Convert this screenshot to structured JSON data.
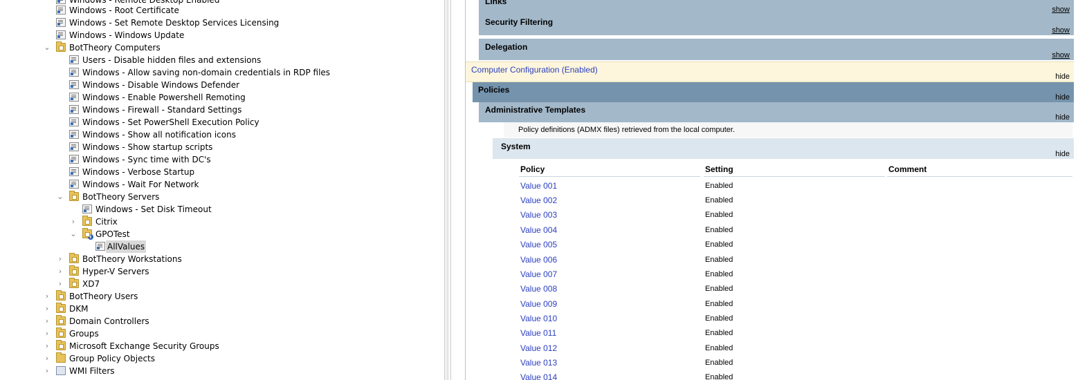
{
  "tree": {
    "items": [
      {
        "label": "Windows - Remote Desktop Enabled",
        "icon": "gpo-link-icon"
      },
      {
        "label": "Windows - Root Certificate",
        "icon": "gpo-link-icon"
      },
      {
        "label": "Windows - Set Remote Desktop Services Licensing",
        "icon": "gpo-link-icon"
      },
      {
        "label": "Windows - Windows Update",
        "icon": "gpo-link-icon"
      },
      {
        "label": "BotTheory Computers",
        "icon": "ou-folder-icon",
        "expander": "⌄"
      },
      {
        "label": "Users - Disable hidden files and extensions",
        "icon": "gpo-link-icon"
      },
      {
        "label": "Windows - Allow saving non-domain credentials in RDP files",
        "icon": "gpo-link-icon"
      },
      {
        "label": "Windows - Disable Windows Defender",
        "icon": "gpo-link-icon"
      },
      {
        "label": "Windows - Enable Powershell Remoting",
        "icon": "gpo-link-icon"
      },
      {
        "label": "Windows - Firewall - Standard Settings",
        "icon": "gpo-link-icon"
      },
      {
        "label": "Windows - Set PowerShell Execution Policy",
        "icon": "gpo-link-icon"
      },
      {
        "label": "Windows - Show all notification icons",
        "icon": "gpo-link-icon"
      },
      {
        "label": "Windows - Show startup scripts",
        "icon": "gpo-link-icon"
      },
      {
        "label": "Windows - Sync time with DC's",
        "icon": "gpo-link-icon"
      },
      {
        "label": "Windows - Verbose Startup",
        "icon": "gpo-link-icon"
      },
      {
        "label": "Windows - Wait For Network",
        "icon": "gpo-link-icon"
      },
      {
        "label": "BotTheory Servers",
        "icon": "ou-folder-icon",
        "expander": "⌄"
      },
      {
        "label": "Windows - Set Disk Timeout",
        "icon": "gpo-link-icon"
      },
      {
        "label": "Citrix",
        "icon": "ou-folder-icon",
        "expander": "›"
      },
      {
        "label": "GPOTest",
        "icon": "ou-folder-info-icon",
        "expander": "⌄"
      },
      {
        "label": "AllValues",
        "icon": "gpo-link-icon",
        "selected": true
      },
      {
        "label": "BotTheory Workstations",
        "icon": "ou-folder-icon",
        "expander": "›"
      },
      {
        "label": "Hyper-V Servers",
        "icon": "ou-folder-icon",
        "expander": "›"
      },
      {
        "label": "XD7",
        "icon": "ou-folder-icon",
        "expander": "›"
      },
      {
        "label": "BotTheory Users",
        "icon": "ou-folder-icon",
        "expander": "›"
      },
      {
        "label": "DKM",
        "icon": "ou-folder-icon",
        "expander": "›"
      },
      {
        "label": "Domain Controllers",
        "icon": "ou-folder-icon",
        "expander": "›"
      },
      {
        "label": "Groups",
        "icon": "ou-folder-icon",
        "expander": "›"
      },
      {
        "label": "Microsoft Exchange Security Groups",
        "icon": "ou-folder-icon",
        "expander": "›"
      },
      {
        "label": "Group Policy Objects",
        "icon": "folder-icon",
        "expander": "›"
      },
      {
        "label": "WMI Filters",
        "icon": "filter-folder-icon",
        "expander": "›"
      }
    ]
  },
  "report": {
    "links": {
      "title": "Links",
      "toggle": "show"
    },
    "security_filtering": {
      "title": "Security Filtering",
      "toggle": "show"
    },
    "delegation": {
      "title": "Delegation",
      "toggle": "show"
    },
    "computer_config": {
      "title": "Computer Configuration (Enabled)",
      "toggle": "hide"
    },
    "policies": {
      "title": "Policies",
      "toggle": "hide"
    },
    "admin_templates": {
      "title": "Administrative Templates",
      "toggle": "hide"
    },
    "admx_note": "Policy definitions (ADMX files) retrieved from the local computer.",
    "system": {
      "title": "System",
      "toggle": "hide"
    },
    "table": {
      "headers": {
        "policy": "Policy",
        "setting": "Setting",
        "comment": "Comment"
      },
      "rows": [
        {
          "policy": "Value 001",
          "setting": "Enabled"
        },
        {
          "policy": "Value 002",
          "setting": "Enabled"
        },
        {
          "policy": "Value 003",
          "setting": "Enabled"
        },
        {
          "policy": "Value 004",
          "setting": "Enabled"
        },
        {
          "policy": "Value 005",
          "setting": "Enabled"
        },
        {
          "policy": "Value 006",
          "setting": "Enabled"
        },
        {
          "policy": "Value 007",
          "setting": "Enabled"
        },
        {
          "policy": "Value 008",
          "setting": "Enabled"
        },
        {
          "policy": "Value 009",
          "setting": "Enabled"
        },
        {
          "policy": "Value 010",
          "setting": "Enabled"
        },
        {
          "policy": "Value 011",
          "setting": "Enabled"
        },
        {
          "policy": "Value 012",
          "setting": "Enabled"
        },
        {
          "policy": "Value 013",
          "setting": "Enabled"
        },
        {
          "policy": "Value 014",
          "setting": "Enabled"
        }
      ]
    }
  },
  "colors": {
    "section_mid": "#a3b8c9",
    "section_dark": "#7593ad",
    "computer_config_bg": "#fdf6dc",
    "system_bg": "#dce6ee",
    "link_blue": "#2a3ec0",
    "selected_bg": "#d9d9d9"
  }
}
